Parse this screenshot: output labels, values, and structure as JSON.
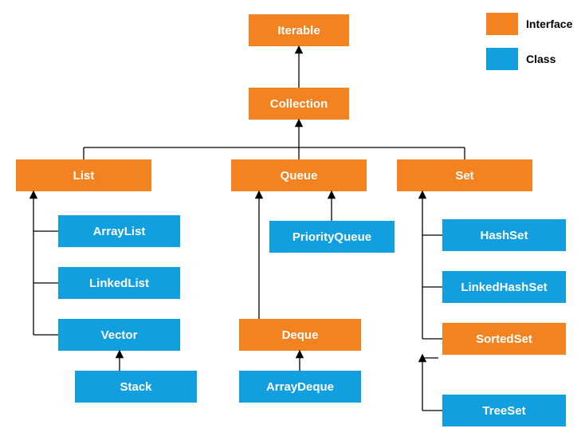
{
  "nodes": {
    "iterable": "Iterable",
    "collection": "Collection",
    "list": "List",
    "queue": "Queue",
    "set": "Set",
    "arraylist": "ArrayList",
    "linkedlist": "LinkedList",
    "vector": "Vector",
    "stack": "Stack",
    "priorityqueue": "PriorityQueue",
    "deque": "Deque",
    "arraydeque": "ArrayDeque",
    "hashset": "HashSet",
    "linkedhashset": "LinkedHashSet",
    "sortedset": "SortedSet",
    "treeset": "TreeSet"
  },
  "legend": {
    "interface": "Interface",
    "class": "Class"
  },
  "colors": {
    "interface": "#f38220",
    "class": "#119fe0"
  },
  "chart_data": {
    "type": "tree",
    "title": "",
    "legend": [
      {
        "label": "Interface",
        "color": "#f38220"
      },
      {
        "label": "Class",
        "color": "#119fe0"
      }
    ],
    "nodes": [
      {
        "id": "Iterable",
        "kind": "interface"
      },
      {
        "id": "Collection",
        "kind": "interface"
      },
      {
        "id": "List",
        "kind": "interface"
      },
      {
        "id": "Queue",
        "kind": "interface"
      },
      {
        "id": "Set",
        "kind": "interface"
      },
      {
        "id": "ArrayList",
        "kind": "class"
      },
      {
        "id": "LinkedList",
        "kind": "class"
      },
      {
        "id": "Vector",
        "kind": "class"
      },
      {
        "id": "Stack",
        "kind": "class"
      },
      {
        "id": "PriorityQueue",
        "kind": "class"
      },
      {
        "id": "Deque",
        "kind": "interface"
      },
      {
        "id": "ArrayDeque",
        "kind": "class"
      },
      {
        "id": "HashSet",
        "kind": "class"
      },
      {
        "id": "LinkedHashSet",
        "kind": "class"
      },
      {
        "id": "SortedSet",
        "kind": "interface"
      },
      {
        "id": "TreeSet",
        "kind": "class"
      }
    ],
    "edges": [
      {
        "from": "Collection",
        "to": "Iterable"
      },
      {
        "from": "List",
        "to": "Collection"
      },
      {
        "from": "Queue",
        "to": "Collection"
      },
      {
        "from": "Set",
        "to": "Collection"
      },
      {
        "from": "ArrayList",
        "to": "List"
      },
      {
        "from": "LinkedList",
        "to": "List"
      },
      {
        "from": "Vector",
        "to": "List"
      },
      {
        "from": "Stack",
        "to": "Vector"
      },
      {
        "from": "PriorityQueue",
        "to": "Queue"
      },
      {
        "from": "Deque",
        "to": "Queue"
      },
      {
        "from": "ArrayDeque",
        "to": "Deque"
      },
      {
        "from": "HashSet",
        "to": "Set"
      },
      {
        "from": "LinkedHashSet",
        "to": "Set"
      },
      {
        "from": "SortedSet",
        "to": "Set"
      },
      {
        "from": "TreeSet",
        "to": "SortedSet"
      }
    ]
  }
}
